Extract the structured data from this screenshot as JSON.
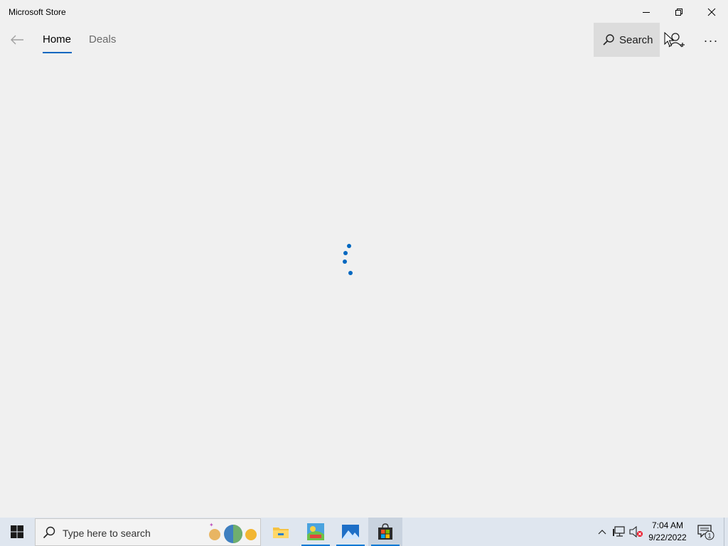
{
  "window": {
    "title": "Microsoft Store",
    "controls": {
      "minimize_icon": "minimize-icon",
      "restore_icon": "restore-icon",
      "close_icon": "close-icon"
    }
  },
  "nav": {
    "back_icon": "back-arrow-icon",
    "tabs": [
      {
        "label": "Home",
        "selected": true
      },
      {
        "label": "Deals",
        "selected": false
      }
    ],
    "search_label": "Search",
    "account_icon": "add-account-icon",
    "more_label": "···"
  },
  "main": {
    "state": "loading",
    "spinner_icon": "loading-spinner-icon"
  },
  "colors": {
    "accent": "#0067c0",
    "background": "#f0f0f0",
    "taskbar": "#dfe6ef"
  },
  "taskbar": {
    "search_placeholder": "Type here to search",
    "apps": [
      {
        "name": "file-explorer",
        "icon": "folder-icon",
        "running": false
      },
      {
        "name": "game",
        "icon": "game-icon",
        "running": true
      },
      {
        "name": "photos",
        "icon": "photos-icon",
        "running": true
      },
      {
        "name": "microsoft-store",
        "icon": "store-bag-icon",
        "running": true,
        "active": true
      }
    ],
    "tray": {
      "chevron_icon": "chevron-up-icon",
      "network_icon": "network-icon",
      "volume_icon": "volume-muted-icon"
    },
    "time": "7:04 AM",
    "date": "9/22/2022",
    "notification_count": "1"
  }
}
